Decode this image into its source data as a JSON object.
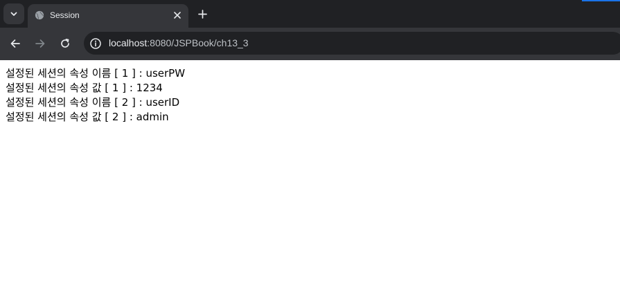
{
  "browser": {
    "tab": {
      "title": "Session",
      "favicon": "globe-icon",
      "close_icon": "close-icon"
    },
    "new_tab_icon": "plus-icon",
    "tab_search_icon": "chevron-down-icon",
    "toolbar": {
      "back_icon": "arrow-left-icon",
      "forward_icon": "arrow-right-icon",
      "reload_icon": "reload-icon",
      "site_info_icon": "info-icon",
      "url_host": "localhost",
      "url_rest": ":8080/JSPBook/ch13_3"
    },
    "colors": {
      "tabstrip": "#202124",
      "active_tab": "#35363a",
      "toolbar": "#35363a",
      "omnibox": "#202124",
      "accent": "#1a73e8"
    }
  },
  "page": {
    "lines": [
      "설정된 세션의 속성 이름 [ 1 ] : userPW",
      "설정된 세션의 속성 값 [ 1 ] : 1234",
      "설정된 세션의 속성 이름 [ 2 ] : userID",
      "설정된 세션의 속성 값 [ 2 ] : admin"
    ]
  }
}
